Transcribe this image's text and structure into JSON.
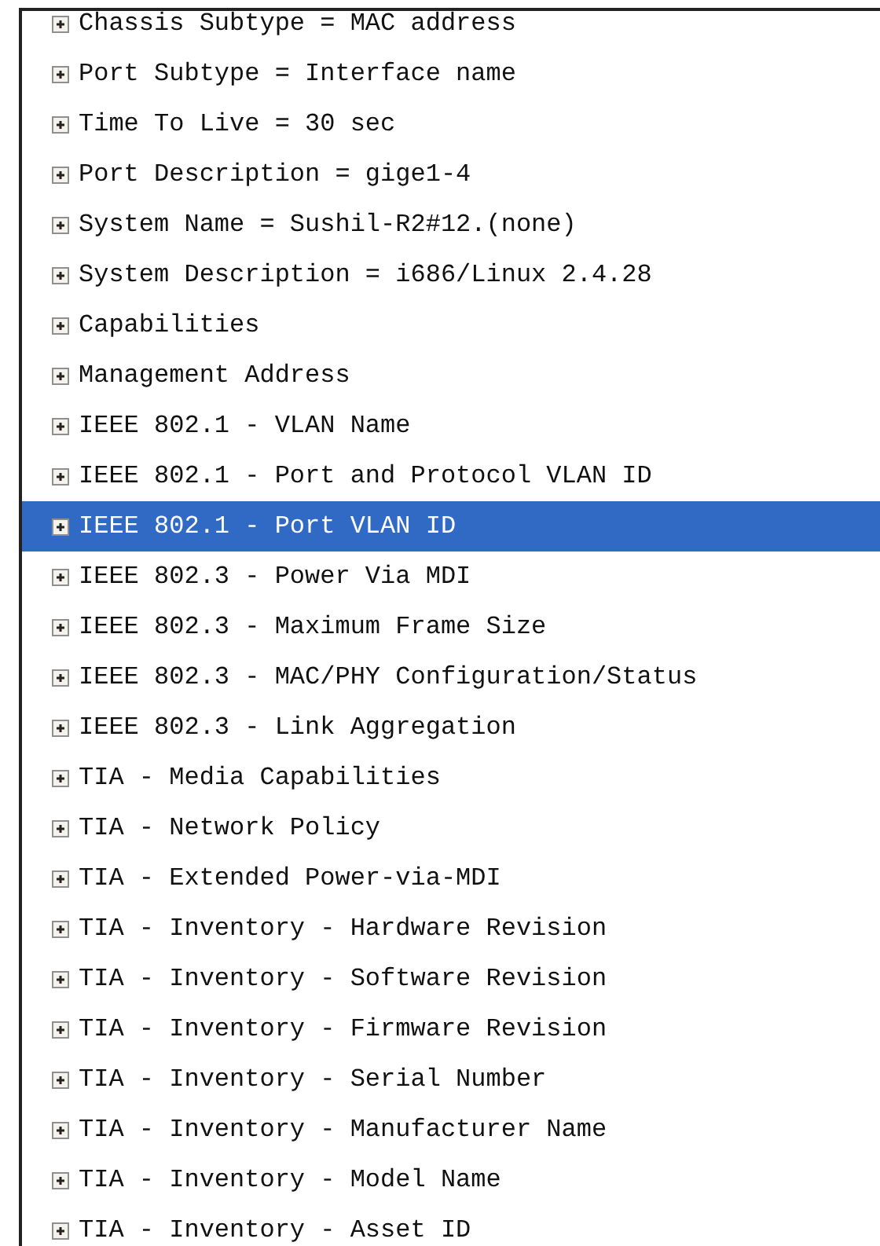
{
  "tree": {
    "items": [
      {
        "label": "Chassis Subtype = MAC address",
        "expanded": false,
        "selected": false
      },
      {
        "label": "Port Subtype = Interface name",
        "expanded": false,
        "selected": false
      },
      {
        "label": "Time To Live = 30 sec",
        "expanded": false,
        "selected": false
      },
      {
        "label": "Port Description = gige1-4",
        "expanded": false,
        "selected": false
      },
      {
        "label": "System Name = Sushil-R2#12.(none)",
        "expanded": false,
        "selected": false
      },
      {
        "label": "System Description = i686/Linux 2.4.28",
        "expanded": false,
        "selected": false
      },
      {
        "label": "Capabilities",
        "expanded": false,
        "selected": false
      },
      {
        "label": "Management Address",
        "expanded": false,
        "selected": false
      },
      {
        "label": "IEEE 802.1 - VLAN Name",
        "expanded": false,
        "selected": false
      },
      {
        "label": "IEEE 802.1 - Port and Protocol VLAN ID",
        "expanded": false,
        "selected": false
      },
      {
        "label": "IEEE 802.1 - Port VLAN ID",
        "expanded": false,
        "selected": true
      },
      {
        "label": "IEEE 802.3 - Power Via MDI",
        "expanded": false,
        "selected": false
      },
      {
        "label": "IEEE 802.3 - Maximum Frame Size",
        "expanded": false,
        "selected": false
      },
      {
        "label": "IEEE 802.3 - MAC/PHY Configuration/Status",
        "expanded": false,
        "selected": false
      },
      {
        "label": "IEEE 802.3 - Link Aggregation",
        "expanded": false,
        "selected": false
      },
      {
        "label": "TIA - Media Capabilities",
        "expanded": false,
        "selected": false
      },
      {
        "label": "TIA - Network Policy",
        "expanded": false,
        "selected": false
      },
      {
        "label": "TIA - Extended Power-via-MDI",
        "expanded": false,
        "selected": false
      },
      {
        "label": "TIA - Inventory - Hardware Revision",
        "expanded": false,
        "selected": false
      },
      {
        "label": "TIA - Inventory - Software Revision",
        "expanded": false,
        "selected": false
      },
      {
        "label": "TIA - Inventory - Firmware Revision",
        "expanded": false,
        "selected": false
      },
      {
        "label": "TIA - Inventory - Serial Number",
        "expanded": false,
        "selected": false
      },
      {
        "label": "TIA - Inventory - Manufacturer Name",
        "expanded": false,
        "selected": false
      },
      {
        "label": "TIA - Inventory - Model Name",
        "expanded": false,
        "selected": false
      },
      {
        "label": "TIA - Inventory - Asset ID",
        "expanded": false,
        "selected": false
      }
    ]
  }
}
